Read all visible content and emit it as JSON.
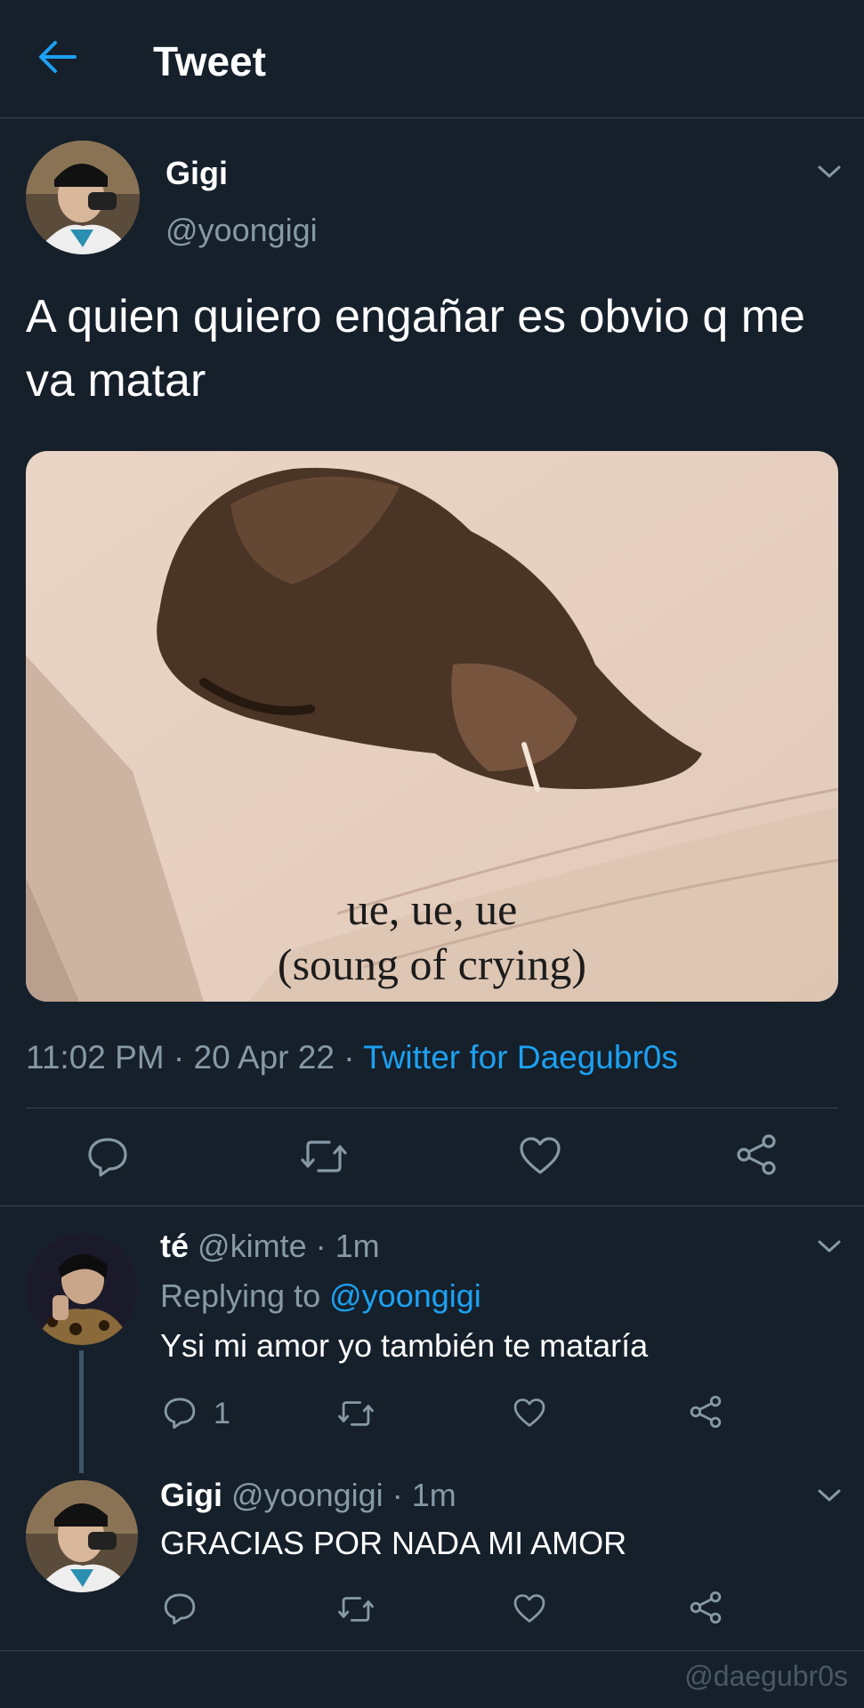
{
  "header": {
    "title": "Tweet"
  },
  "tweet": {
    "author_name": "Gigi",
    "author_handle": "@yoongigi",
    "text": "A quien quiero engañar es obvio q me va matar",
    "image": {
      "caption_line1": "ue, ue, ue",
      "caption_line2": "(soung of crying)"
    },
    "time": "11:02 PM",
    "date": "20 Apr 22",
    "sep": "·",
    "source": "Twitter for Daegubr0s"
  },
  "replies": [
    {
      "name": "té",
      "handle": "@kimte",
      "time": "1m",
      "sep": "·",
      "replying_prefix": "Replying to",
      "replying_to": "@yoongigi",
      "text": "Ysi mi amor yo también te mataría",
      "reply_count": "1"
    },
    {
      "name": "Gigi",
      "handle": "@yoongigi",
      "time": "1m",
      "sep": "·",
      "text": "GRACIAS POR NADA MI AMOR"
    }
  ],
  "watermark": "@daegubr0s",
  "colors": {
    "background": "#15202b",
    "accent": "#1da1f2",
    "muted": "#8899a6",
    "divider": "#38444d"
  }
}
